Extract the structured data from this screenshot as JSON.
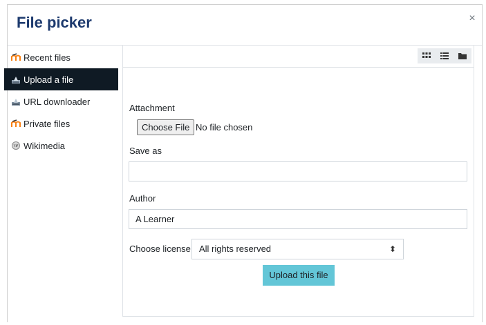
{
  "dialog": {
    "title": "File picker",
    "close_label": "×"
  },
  "sidebar": {
    "items": [
      {
        "label": "Recent files",
        "icon": "moodle-icon"
      },
      {
        "label": "Upload a file",
        "icon": "upload-icon",
        "active": true
      },
      {
        "label": "URL downloader",
        "icon": "url-download-icon"
      },
      {
        "label": "Private files",
        "icon": "moodle-icon"
      },
      {
        "label": "Wikimedia",
        "icon": "wikimedia-icon"
      }
    ]
  },
  "toolbar": {
    "views": [
      "icons-view",
      "list-view",
      "tree-view"
    ]
  },
  "form": {
    "attachment_label": "Attachment",
    "choose_file_label": "Choose File",
    "no_file_text": "No file chosen",
    "save_as_label": "Save as",
    "save_as_value": "",
    "author_label": "Author",
    "author_value": "A Learner",
    "license_label": "Choose license",
    "license_value": "All rights reserved",
    "upload_button": "Upload this file"
  },
  "colors": {
    "title": "#1d3a6e",
    "active_nav": "#0f1a24",
    "upload_button": "#63c6d7"
  }
}
